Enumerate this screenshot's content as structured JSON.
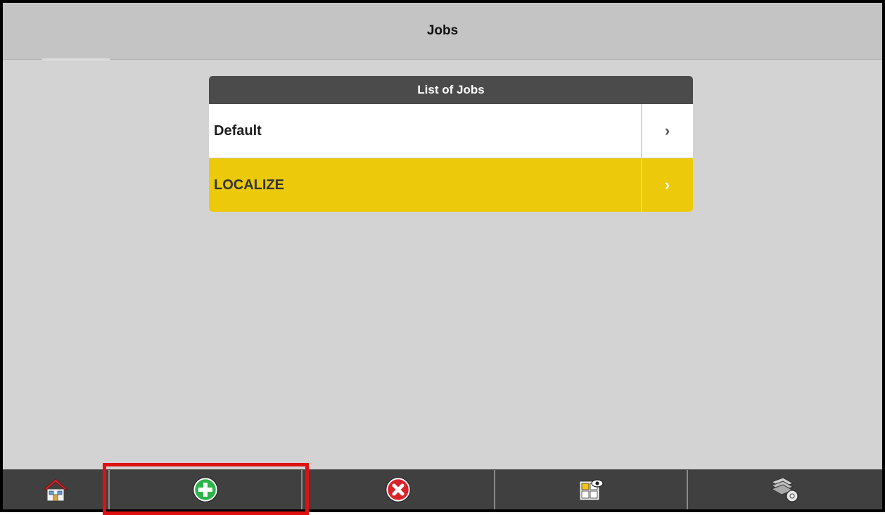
{
  "header": {
    "title": "Jobs"
  },
  "list": {
    "title": "List of Jobs",
    "items": [
      {
        "label": "Default",
        "arrow": "›",
        "selected": false
      },
      {
        "label": "LOCALIZE",
        "arrow": "›",
        "selected": true
      }
    ]
  },
  "toolbar": {
    "buttons": [
      {
        "name": "home",
        "icon": "home-icon"
      },
      {
        "name": "add",
        "icon": "add-circle-icon"
      },
      {
        "name": "delete",
        "icon": "delete-circle-icon"
      },
      {
        "name": "view",
        "icon": "view-grid-eye-icon"
      },
      {
        "name": "settings",
        "icon": "layers-gear-icon"
      }
    ]
  },
  "colors": {
    "header_bg": "#c4c4c4",
    "body_bg": "#d3d3d3",
    "card_header": "#4b4b4b",
    "selected_row": "#ecc90a",
    "toolbar_bg": "#404040",
    "highlight": "#e01010",
    "add_icon": "#2db34a",
    "delete_icon": "#d8232a"
  }
}
